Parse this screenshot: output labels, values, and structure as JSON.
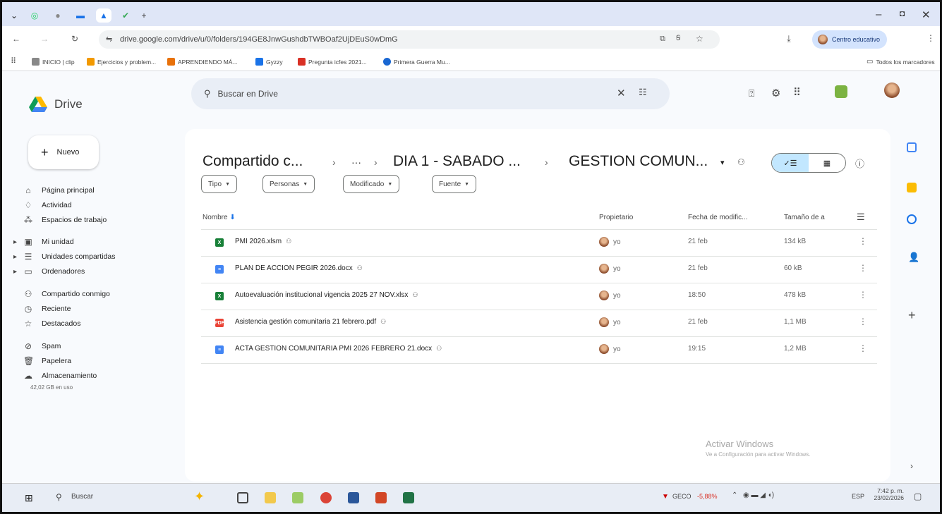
{
  "browser": {
    "url": "drive.google.com/drive/u/0/folders/194GE8JnwGushdbTWBOaf2UjDEuS0wDmG",
    "profile_label": "Centro educativo",
    "bookmarks": [
      "INICIO | clip",
      "Ejercicios y problem...",
      "APRENDIENDO MÁ...",
      "Gyzzy",
      "Pregunta icfes 2021...",
      "Primera Guerra Mu..."
    ],
    "all_bookmarks": "Todos los marcadores"
  },
  "drive": {
    "app_name": "Drive",
    "search_placeholder": "Buscar en Drive",
    "new_label": "Nuevo",
    "nav": {
      "home": "Página principal",
      "activity": "Actividad",
      "workspaces": "Espacios de trabajo",
      "my_drive": "Mi unidad",
      "shared_drives": "Unidades compartidas",
      "computers": "Ordenadores",
      "shared_with_me": "Compartido conmigo",
      "recent": "Reciente",
      "starred": "Destacados",
      "spam": "Spam",
      "trash": "Papelera",
      "storage": "Almacenamiento",
      "storage_used": "42,02 GB en uso"
    },
    "breadcrumb": {
      "root": "Compartido c...",
      "ellipsis": "···",
      "parent": "DIA 1 - SABADO ...",
      "current": "GESTION COMUN..."
    },
    "filters": [
      "Tipo",
      "Personas",
      "Modificado",
      "Fuente"
    ],
    "columns": {
      "name": "Nombre",
      "owner": "Propietario",
      "modified": "Fecha de modific...",
      "size": "Tamaño de a"
    },
    "files": [
      {
        "name": "PMI 2026.xlsm",
        "type": "xls",
        "color": "#188038",
        "owner": "yo",
        "modified": "21 feb",
        "size": "134 kB"
      },
      {
        "name": "PLAN DE ACCION PEGIR 2026.docx",
        "type": "doc",
        "color": "#4285f4",
        "owner": "yo",
        "modified": "21 feb",
        "size": "60 kB"
      },
      {
        "name": "Autoevaluación institucional vigencia 2025 27 NOV.xlsx",
        "type": "xls",
        "color": "#188038",
        "owner": "yo",
        "modified": "18:50",
        "size": "478 kB"
      },
      {
        "name": "Asistencia gestión comunitaria 21 febrero.pdf",
        "type": "pdf",
        "color": "#ea4335",
        "owner": "yo",
        "modified": "21 feb",
        "size": "1,1 MB"
      },
      {
        "name": "ACTA GESTION COMUNITARIA PMI 2026 FEBRERO 21.docx",
        "type": "doc",
        "color": "#4285f4",
        "owner": "yo",
        "modified": "19:15",
        "size": "1,2 MB"
      }
    ]
  },
  "watermark": {
    "title": "Activar Windows",
    "subtitle": "Ve a Configuración para activar Windows."
  },
  "taskbar": {
    "search_label": "Buscar",
    "stock_label": "GECO",
    "stock_change": "-5,88%",
    "lang": "ESP",
    "time": "7:42 p. m.",
    "date": "23/02/2026"
  }
}
